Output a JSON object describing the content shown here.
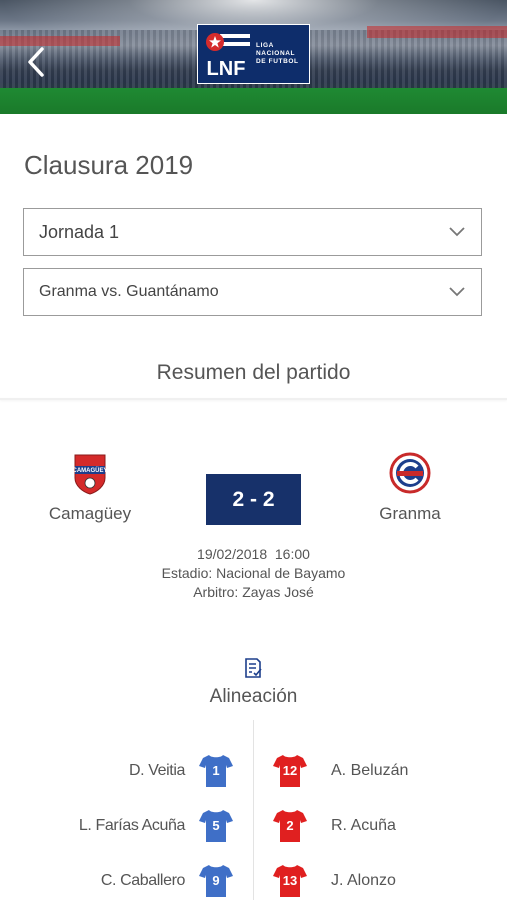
{
  "header": {
    "logo_letters": "LNF",
    "logo_text_lines": [
      "LIGA",
      "NACIONAL",
      "DE FUTBOL"
    ]
  },
  "season_title": "Clausura 2019",
  "selects": {
    "round": "Jornada 1",
    "match": "Granma vs. Guantánamo"
  },
  "summary_title": "Resumen del partido",
  "match": {
    "home_team": "Camagüey",
    "away_team": "Granma",
    "score": "2 - 2",
    "datetime": "19/02/2018  16:00",
    "stadium": "Estadio: Nacional de Bayamo",
    "referee": "Arbitro: Zayas José"
  },
  "lineup": {
    "title": "Alineación",
    "home_color": "#3f6fc7",
    "away_color": "#e02020",
    "home": [
      {
        "name": "D. Veitia",
        "number": "1"
      },
      {
        "name": "L. Farías Acuña",
        "number": "5"
      },
      {
        "name": "C. Caballero",
        "number": "9"
      }
    ],
    "away": [
      {
        "name": "A. Beluzán",
        "number": "12"
      },
      {
        "name": "R. Acuña",
        "number": "2"
      },
      {
        "name": "J. Alonzo",
        "number": "13"
      }
    ]
  },
  "colors": {
    "accent": "#17316a",
    "logo_bg": "#0e2d6b"
  }
}
